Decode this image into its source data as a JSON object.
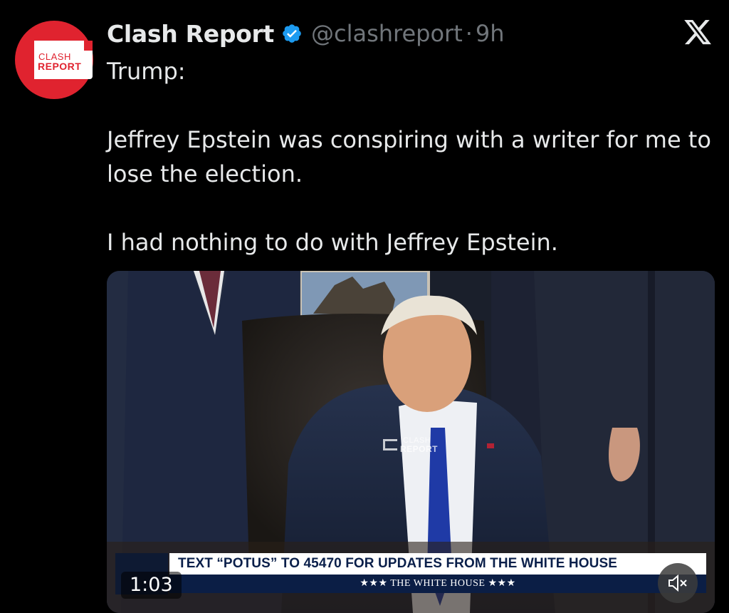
{
  "author": {
    "name": "Clash Report",
    "handle": "@clashreport",
    "separator": "·",
    "time": "9h",
    "avatar_line1": "CLASH",
    "avatar_line2": "REPORT",
    "avatar_color": "#e0232f",
    "verified_icon": "verified-badge-icon",
    "verified_color": "#1d9bf0"
  },
  "platform_icon": "x-logo-icon",
  "tweet": {
    "paragraphs": [
      "Trump:",
      "Jeffrey Epstein was conspiring with a writer for me to lose the election.",
      "I had nothing to do with Jeffrey Epstein."
    ]
  },
  "video": {
    "watermark_line1": "CLASH",
    "watermark_line2": "REPORT",
    "banner_text": "TEXT “POTUS” TO 45470 FOR UPDATES FROM THE WHITE HOUSE",
    "banner_subtext": "★★★  THE WHITE HOUSE  ★★★",
    "duration": "1:03",
    "mute_icon": "speaker-muted-icon"
  },
  "colors": {
    "background": "#000000",
    "text": "#e7e9ea",
    "secondary_text": "#71767b"
  }
}
